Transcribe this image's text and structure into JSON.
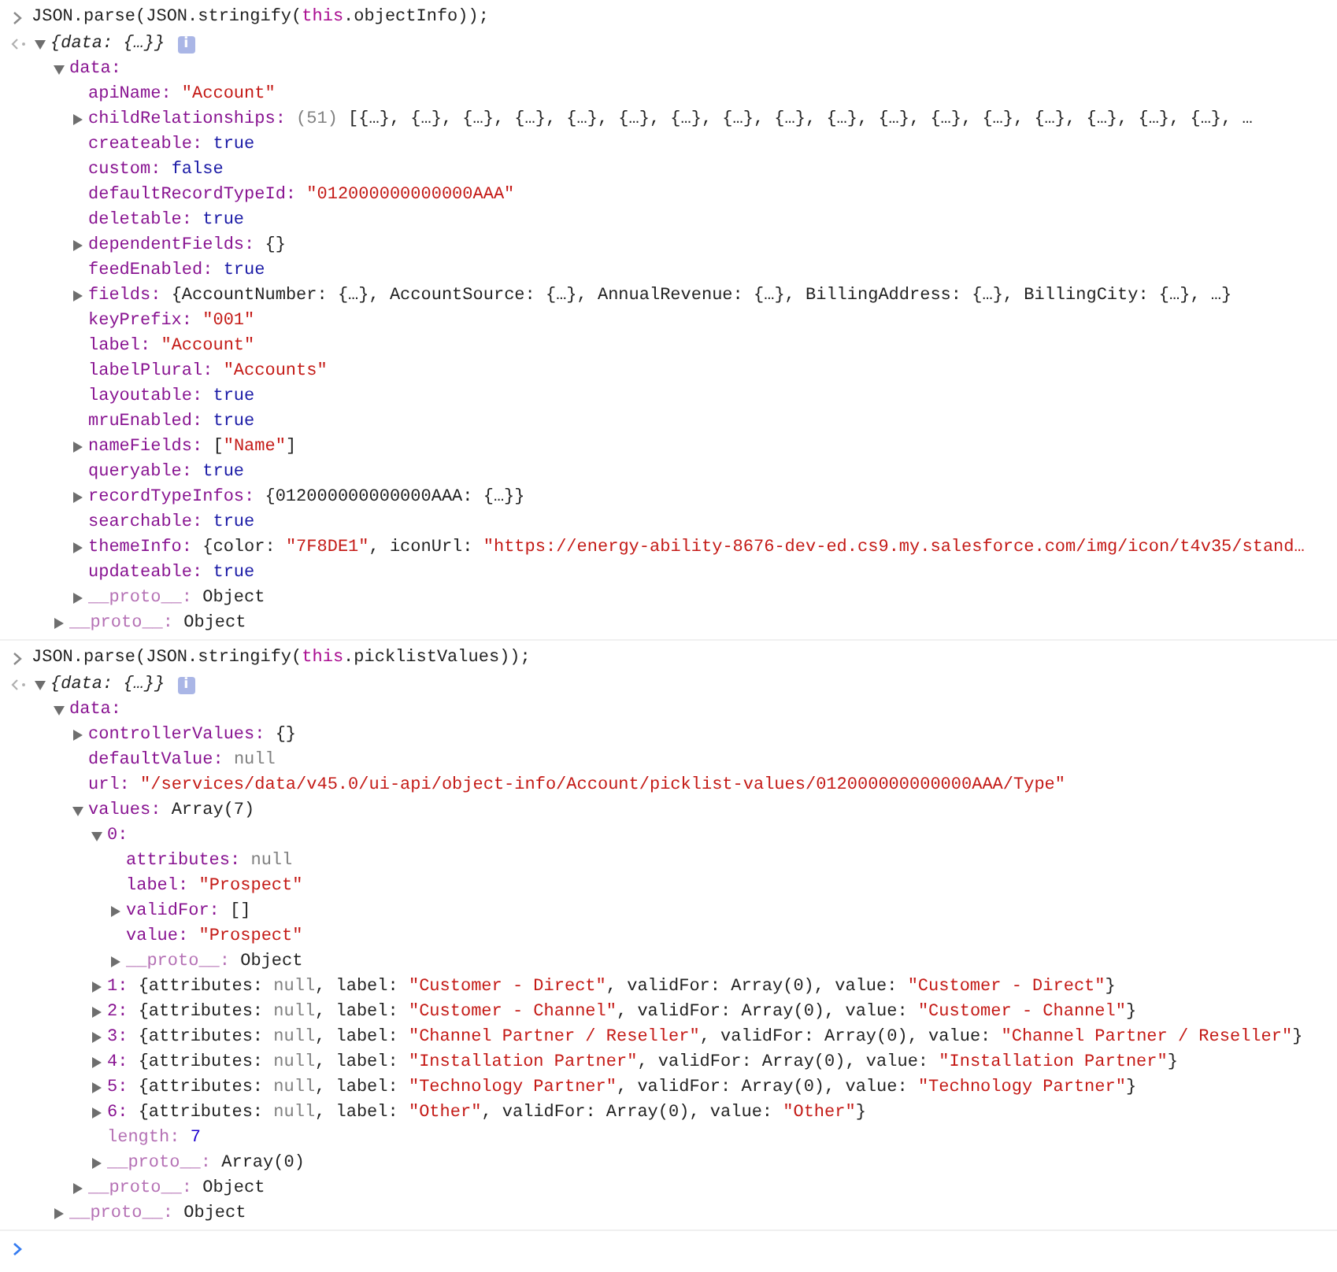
{
  "entries": [
    {
      "input": [
        {
          "kind": "plain",
          "text": "JSON.parse(JSON.stringify("
        },
        {
          "kind": "this",
          "text": "this"
        },
        {
          "kind": "plain",
          "text": ".objectInfo));"
        }
      ],
      "output": {
        "expanded": true,
        "info_badge": "i",
        "value": [
          {
            "kind": "preview",
            "text": "{data: {…}}"
          }
        ],
        "children": [
          {
            "key": "data:",
            "expanded": true,
            "children": [
              {
                "key": "apiName:",
                "value": [
                  {
                    "kind": "string",
                    "text": "\"Account\""
                  }
                ]
              },
              {
                "key": "childRelationships:",
                "expanded": false,
                "value": [
                  {
                    "kind": "count",
                    "text": "(51)"
                  },
                  {
                    "kind": "plain",
                    "text": " [{…}, {…}, {…}, {…}, {…}, {…}, {…}, {…}, {…}, {…}, {…}, {…}, {…}, {…}, {…}, {…}, {…}, …"
                  }
                ]
              },
              {
                "key": "createable:",
                "value": [
                  {
                    "kind": "keyword",
                    "text": "true"
                  }
                ]
              },
              {
                "key": "custom:",
                "value": [
                  {
                    "kind": "keyword",
                    "text": "false"
                  }
                ]
              },
              {
                "key": "defaultRecordTypeId:",
                "value": [
                  {
                    "kind": "string",
                    "text": "\"012000000000000AAA\""
                  }
                ]
              },
              {
                "key": "deletable:",
                "value": [
                  {
                    "kind": "keyword",
                    "text": "true"
                  }
                ]
              },
              {
                "key": "dependentFields:",
                "expanded": false,
                "value": [
                  {
                    "kind": "plain",
                    "text": "{}"
                  }
                ]
              },
              {
                "key": "feedEnabled:",
                "value": [
                  {
                    "kind": "keyword",
                    "text": "true"
                  }
                ]
              },
              {
                "key": "fields:",
                "expanded": false,
                "value": [
                  {
                    "kind": "plain",
                    "text": "{AccountNumber: {…}, AccountSource: {…}, AnnualRevenue: {…}, BillingAddress: {…}, BillingCity: {…}, …}"
                  }
                ]
              },
              {
                "key": "keyPrefix:",
                "value": [
                  {
                    "kind": "string",
                    "text": "\"001\""
                  }
                ]
              },
              {
                "key": "label:",
                "value": [
                  {
                    "kind": "string",
                    "text": "\"Account\""
                  }
                ]
              },
              {
                "key": "labelPlural:",
                "value": [
                  {
                    "kind": "string",
                    "text": "\"Accounts\""
                  }
                ]
              },
              {
                "key": "layoutable:",
                "value": [
                  {
                    "kind": "keyword",
                    "text": "true"
                  }
                ]
              },
              {
                "key": "mruEnabled:",
                "value": [
                  {
                    "kind": "keyword",
                    "text": "true"
                  }
                ]
              },
              {
                "key": "nameFields:",
                "expanded": false,
                "value": [
                  {
                    "kind": "plain",
                    "text": "["
                  },
                  {
                    "kind": "string",
                    "text": "\"Name\""
                  },
                  {
                    "kind": "plain",
                    "text": "]"
                  }
                ]
              },
              {
                "key": "queryable:",
                "value": [
                  {
                    "kind": "keyword",
                    "text": "true"
                  }
                ]
              },
              {
                "key": "recordTypeInfos:",
                "expanded": false,
                "value": [
                  {
                    "kind": "plain",
                    "text": "{012000000000000AAA: {…}}"
                  }
                ]
              },
              {
                "key": "searchable:",
                "value": [
                  {
                    "kind": "keyword",
                    "text": "true"
                  }
                ]
              },
              {
                "key": "themeInfo:",
                "expanded": false,
                "value": [
                  {
                    "kind": "plain",
                    "text": "{color: "
                  },
                  {
                    "kind": "string",
                    "text": "\"7F8DE1\""
                  },
                  {
                    "kind": "plain",
                    "text": ", iconUrl: "
                  },
                  {
                    "kind": "string",
                    "text": "\"https://energy-ability-8676-dev-ed.cs9.my.salesforce.com/img/icon/t4v35/stand…"
                  }
                ]
              },
              {
                "key": "updateable:",
                "value": [
                  {
                    "kind": "keyword",
                    "text": "true"
                  }
                ]
              },
              {
                "key": "__proto__:",
                "kind": "internal",
                "expanded": false,
                "value": [
                  {
                    "kind": "plain",
                    "text": "Object"
                  }
                ]
              }
            ]
          },
          {
            "key": "__proto__:",
            "kind": "internal",
            "expanded": false,
            "value": [
              {
                "kind": "plain",
                "text": "Object"
              }
            ]
          }
        ]
      }
    },
    {
      "input": [
        {
          "kind": "plain",
          "text": "JSON.parse(JSON.stringify("
        },
        {
          "kind": "this",
          "text": "this"
        },
        {
          "kind": "plain",
          "text": ".picklistValues));"
        }
      ],
      "output": {
        "expanded": true,
        "info_badge": "i",
        "value": [
          {
            "kind": "preview",
            "text": "{data: {…}}"
          }
        ],
        "children": [
          {
            "key": "data:",
            "expanded": true,
            "children": [
              {
                "key": "controllerValues:",
                "expanded": false,
                "value": [
                  {
                    "kind": "plain",
                    "text": "{}"
                  }
                ]
              },
              {
                "key": "defaultValue:",
                "value": [
                  {
                    "kind": "null",
                    "text": "null"
                  }
                ]
              },
              {
                "key": "url:",
                "value": [
                  {
                    "kind": "string",
                    "text": "\"/services/data/v45.0/ui-api/object-info/Account/picklist-values/012000000000000AAA/Type\""
                  }
                ]
              },
              {
                "key": "values:",
                "expanded": true,
                "value": [
                  {
                    "kind": "plain",
                    "text": "Array(7)"
                  }
                ],
                "children": [
                  {
                    "key": "0:",
                    "expanded": true,
                    "children": [
                      {
                        "key": "attributes:",
                        "value": [
                          {
                            "kind": "null",
                            "text": "null"
                          }
                        ]
                      },
                      {
                        "key": "label:",
                        "value": [
                          {
                            "kind": "string",
                            "text": "\"Prospect\""
                          }
                        ]
                      },
                      {
                        "key": "validFor:",
                        "expanded": false,
                        "value": [
                          {
                            "kind": "plain",
                            "text": "[]"
                          }
                        ]
                      },
                      {
                        "key": "value:",
                        "value": [
                          {
                            "kind": "string",
                            "text": "\"Prospect\""
                          }
                        ]
                      },
                      {
                        "key": "__proto__:",
                        "kind": "internal",
                        "expanded": false,
                        "value": [
                          {
                            "kind": "plain",
                            "text": "Object"
                          }
                        ]
                      }
                    ]
                  },
                  {
                    "key": "1:",
                    "expanded": false,
                    "value": [
                      {
                        "kind": "plain",
                        "text": "{attributes: "
                      },
                      {
                        "kind": "null",
                        "text": "null"
                      },
                      {
                        "kind": "plain",
                        "text": ", label: "
                      },
                      {
                        "kind": "string",
                        "text": "\"Customer - Direct\""
                      },
                      {
                        "kind": "plain",
                        "text": ", validFor: Array(0), value: "
                      },
                      {
                        "kind": "string",
                        "text": "\"Customer - Direct\""
                      },
                      {
                        "kind": "plain",
                        "text": "}"
                      }
                    ]
                  },
                  {
                    "key": "2:",
                    "expanded": false,
                    "value": [
                      {
                        "kind": "plain",
                        "text": "{attributes: "
                      },
                      {
                        "kind": "null",
                        "text": "null"
                      },
                      {
                        "kind": "plain",
                        "text": ", label: "
                      },
                      {
                        "kind": "string",
                        "text": "\"Customer - Channel\""
                      },
                      {
                        "kind": "plain",
                        "text": ", validFor: Array(0), value: "
                      },
                      {
                        "kind": "string",
                        "text": "\"Customer - Channel\""
                      },
                      {
                        "kind": "plain",
                        "text": "}"
                      }
                    ]
                  },
                  {
                    "key": "3:",
                    "expanded": false,
                    "value": [
                      {
                        "kind": "plain",
                        "text": "{attributes: "
                      },
                      {
                        "kind": "null",
                        "text": "null"
                      },
                      {
                        "kind": "plain",
                        "text": ", label: "
                      },
                      {
                        "kind": "string",
                        "text": "\"Channel Partner / Reseller\""
                      },
                      {
                        "kind": "plain",
                        "text": ", validFor: Array(0), value: "
                      },
                      {
                        "kind": "string",
                        "text": "\"Channel Partner / Reseller\""
                      },
                      {
                        "kind": "plain",
                        "text": "}"
                      }
                    ]
                  },
                  {
                    "key": "4:",
                    "expanded": false,
                    "value": [
                      {
                        "kind": "plain",
                        "text": "{attributes: "
                      },
                      {
                        "kind": "null",
                        "text": "null"
                      },
                      {
                        "kind": "plain",
                        "text": ", label: "
                      },
                      {
                        "kind": "string",
                        "text": "\"Installation Partner\""
                      },
                      {
                        "kind": "plain",
                        "text": ", validFor: Array(0), value: "
                      },
                      {
                        "kind": "string",
                        "text": "\"Installation Partner\""
                      },
                      {
                        "kind": "plain",
                        "text": "}"
                      }
                    ]
                  },
                  {
                    "key": "5:",
                    "expanded": false,
                    "value": [
                      {
                        "kind": "plain",
                        "text": "{attributes: "
                      },
                      {
                        "kind": "null",
                        "text": "null"
                      },
                      {
                        "kind": "plain",
                        "text": ", label: "
                      },
                      {
                        "kind": "string",
                        "text": "\"Technology Partner\""
                      },
                      {
                        "kind": "plain",
                        "text": ", validFor: Array(0), value: "
                      },
                      {
                        "kind": "string",
                        "text": "\"Technology Partner\""
                      },
                      {
                        "kind": "plain",
                        "text": "}"
                      }
                    ]
                  },
                  {
                    "key": "6:",
                    "expanded": false,
                    "value": [
                      {
                        "kind": "plain",
                        "text": "{attributes: "
                      },
                      {
                        "kind": "null",
                        "text": "null"
                      },
                      {
                        "kind": "plain",
                        "text": ", label: "
                      },
                      {
                        "kind": "string",
                        "text": "\"Other\""
                      },
                      {
                        "kind": "plain",
                        "text": ", validFor: Array(0), value: "
                      },
                      {
                        "kind": "string",
                        "text": "\"Other\""
                      },
                      {
                        "kind": "plain",
                        "text": "}"
                      }
                    ]
                  },
                  {
                    "key": "length:",
                    "kind": "internal",
                    "value": [
                      {
                        "kind": "number",
                        "text": "7"
                      }
                    ]
                  },
                  {
                    "key": "__proto__:",
                    "kind": "internal",
                    "expanded": false,
                    "value": [
                      {
                        "kind": "plain",
                        "text": "Array(0)"
                      }
                    ]
                  }
                ]
              },
              {
                "key": "__proto__:",
                "kind": "internal",
                "expanded": false,
                "value": [
                  {
                    "kind": "plain",
                    "text": "Object"
                  }
                ]
              }
            ]
          },
          {
            "key": "__proto__:",
            "kind": "internal",
            "expanded": false,
            "value": [
              {
                "kind": "plain",
                "text": "Object"
              }
            ]
          }
        ]
      }
    }
  ]
}
